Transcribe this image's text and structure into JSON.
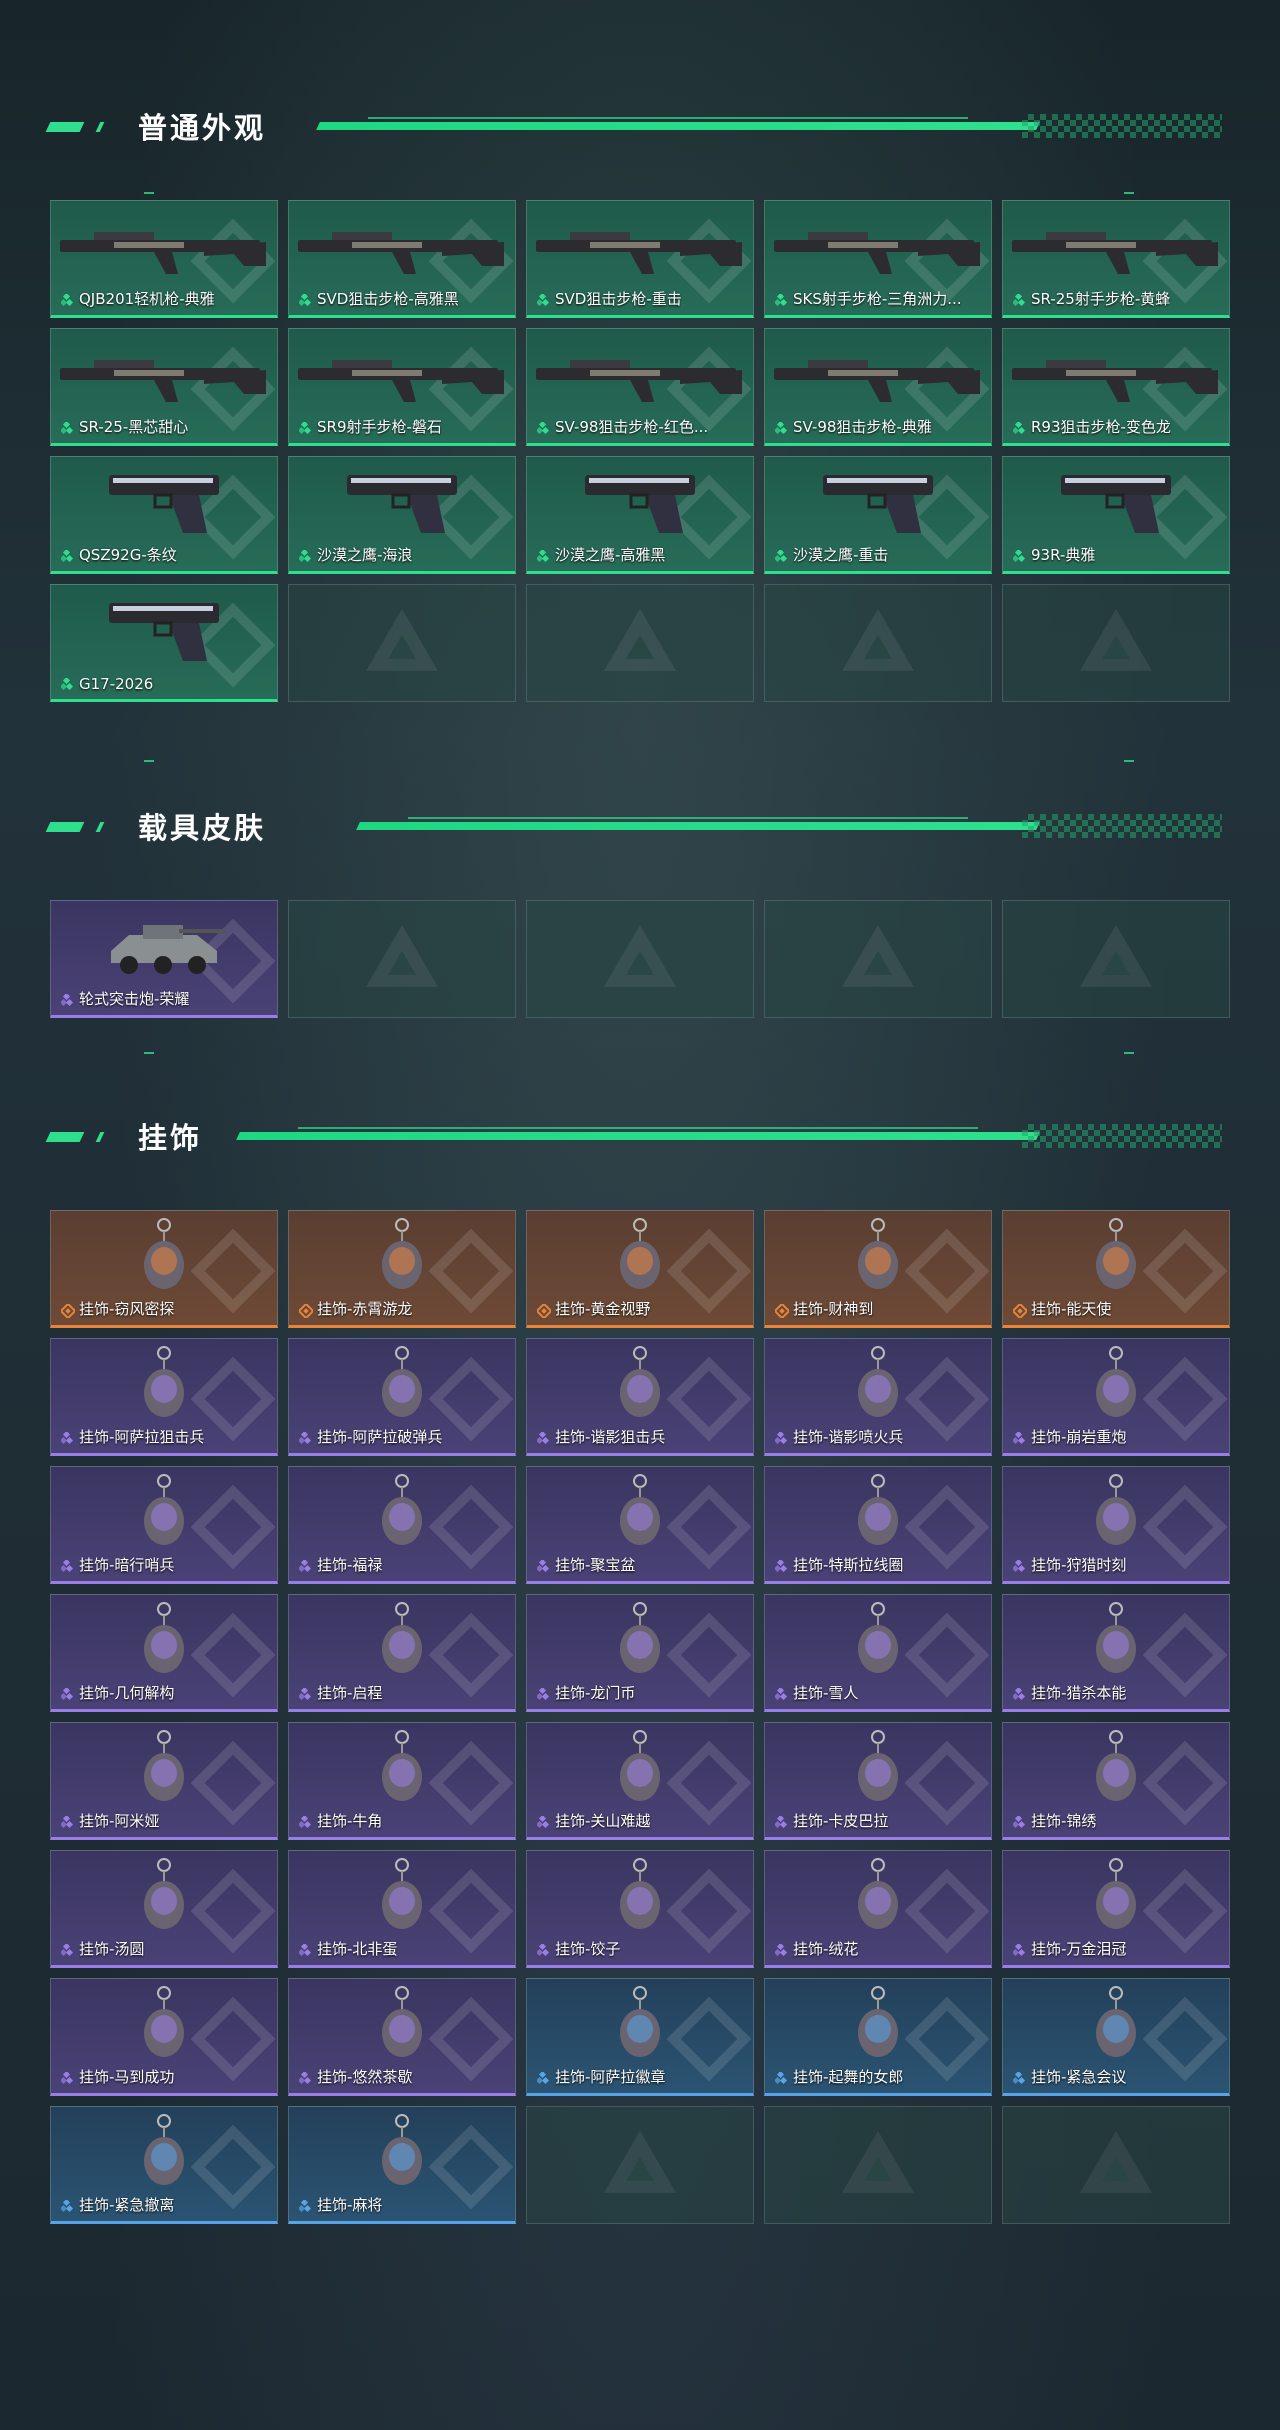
{
  "sections": {
    "normal": {
      "title": "普通外观"
    },
    "vehicle": {
      "title": "载具皮肤"
    },
    "charm": {
      "title": "挂饰"
    }
  },
  "normal_items": [
    {
      "label": "QJB201轻机枪-典雅",
      "rarity": "green",
      "icon": "lmg-icon"
    },
    {
      "label": "SVD狙击步枪-高雅黑",
      "rarity": "green",
      "icon": "sniper-rifle-icon"
    },
    {
      "label": "SVD狙击步枪-重击",
      "rarity": "green",
      "icon": "sniper-rifle-icon"
    },
    {
      "label": "SKS射手步枪-三角洲力...",
      "rarity": "green",
      "icon": "rifle-icon"
    },
    {
      "label": "SR-25射手步枪-黄蜂",
      "rarity": "green",
      "icon": "rifle-icon"
    },
    {
      "label": "SR-25-黑芯甜心",
      "rarity": "green",
      "icon": "rifle-icon"
    },
    {
      "label": "SR9射手步枪-磐石",
      "rarity": "green",
      "icon": "rifle-icon"
    },
    {
      "label": "SV-98狙击步枪-红色...",
      "rarity": "green",
      "icon": "sniper-rifle-icon"
    },
    {
      "label": "SV-98狙击步枪-典雅",
      "rarity": "green",
      "icon": "sniper-rifle-icon"
    },
    {
      "label": "R93狙击步枪-变色龙",
      "rarity": "green",
      "icon": "sniper-rifle-icon"
    },
    {
      "label": "QSZ92G-条纹",
      "rarity": "green",
      "icon": "pistol-icon"
    },
    {
      "label": "沙漠之鹰-海浪",
      "rarity": "green",
      "icon": "pistol-icon"
    },
    {
      "label": "沙漠之鹰-高雅黑",
      "rarity": "green",
      "icon": "pistol-icon"
    },
    {
      "label": "沙漠之鹰-重击",
      "rarity": "green",
      "icon": "pistol-icon"
    },
    {
      "label": "93R-典雅",
      "rarity": "green",
      "icon": "pistol-icon"
    },
    {
      "label": "G17-2026",
      "rarity": "green",
      "icon": "pistol-icon"
    }
  ],
  "vehicle_items": [
    {
      "label": "轮式突击炮-荣耀",
      "rarity": "purple",
      "icon": "armored-vehicle-icon"
    }
  ],
  "charm_items": [
    {
      "label": "挂饰-窃风密探",
      "rarity": "orange"
    },
    {
      "label": "挂饰-赤霄游龙",
      "rarity": "orange"
    },
    {
      "label": "挂饰-黄金视野",
      "rarity": "orange"
    },
    {
      "label": "挂饰-财神到",
      "rarity": "orange"
    },
    {
      "label": "挂饰-能天使",
      "rarity": "orange"
    },
    {
      "label": "挂饰-阿萨拉狙击兵",
      "rarity": "purple"
    },
    {
      "label": "挂饰-阿萨拉破弹兵",
      "rarity": "purple"
    },
    {
      "label": "挂饰-谐影狙击兵",
      "rarity": "purple"
    },
    {
      "label": "挂饰-谐影喷火兵",
      "rarity": "purple"
    },
    {
      "label": "挂饰-崩岩重炮",
      "rarity": "purple"
    },
    {
      "label": "挂饰-暗行哨兵",
      "rarity": "purple"
    },
    {
      "label": "挂饰-福禄",
      "rarity": "purple"
    },
    {
      "label": "挂饰-聚宝盆",
      "rarity": "purple"
    },
    {
      "label": "挂饰-特斯拉线圈",
      "rarity": "purple"
    },
    {
      "label": "挂饰-狩猎时刻",
      "rarity": "purple"
    },
    {
      "label": "挂饰-几何解构",
      "rarity": "purple"
    },
    {
      "label": "挂饰-启程",
      "rarity": "purple"
    },
    {
      "label": "挂饰-龙门币",
      "rarity": "purple"
    },
    {
      "label": "挂饰-雪人",
      "rarity": "purple"
    },
    {
      "label": "挂饰-猎杀本能",
      "rarity": "purple"
    },
    {
      "label": "挂饰-阿米娅",
      "rarity": "purple"
    },
    {
      "label": "挂饰-牛角",
      "rarity": "purple"
    },
    {
      "label": "挂饰-关山难越",
      "rarity": "purple"
    },
    {
      "label": "挂饰-卡皮巴拉",
      "rarity": "purple"
    },
    {
      "label": "挂饰-锦绣",
      "rarity": "purple"
    },
    {
      "label": "挂饰-汤圆",
      "rarity": "purple"
    },
    {
      "label": "挂饰-北非蛋",
      "rarity": "purple"
    },
    {
      "label": "挂饰-饺子",
      "rarity": "purple"
    },
    {
      "label": "挂饰-绒花",
      "rarity": "purple"
    },
    {
      "label": "挂饰-万金泪冠",
      "rarity": "purple"
    },
    {
      "label": "挂饰-马到成功",
      "rarity": "purple"
    },
    {
      "label": "挂饰-悠然茶歇",
      "rarity": "purple"
    },
    {
      "label": "挂饰-阿萨拉徽章",
      "rarity": "blue"
    },
    {
      "label": "挂饰-起舞的女郎",
      "rarity": "blue"
    },
    {
      "label": "挂饰-紧急会议",
      "rarity": "blue"
    },
    {
      "label": "挂饰-紧急撤离",
      "rarity": "blue"
    },
    {
      "label": "挂饰-麻将",
      "rarity": "blue"
    }
  ],
  "colors": {
    "accent": "#2ee08e",
    "green": "#2ee08e",
    "purple": "#9a7ee8",
    "orange": "#e8843a",
    "blue": "#58a4e8"
  }
}
